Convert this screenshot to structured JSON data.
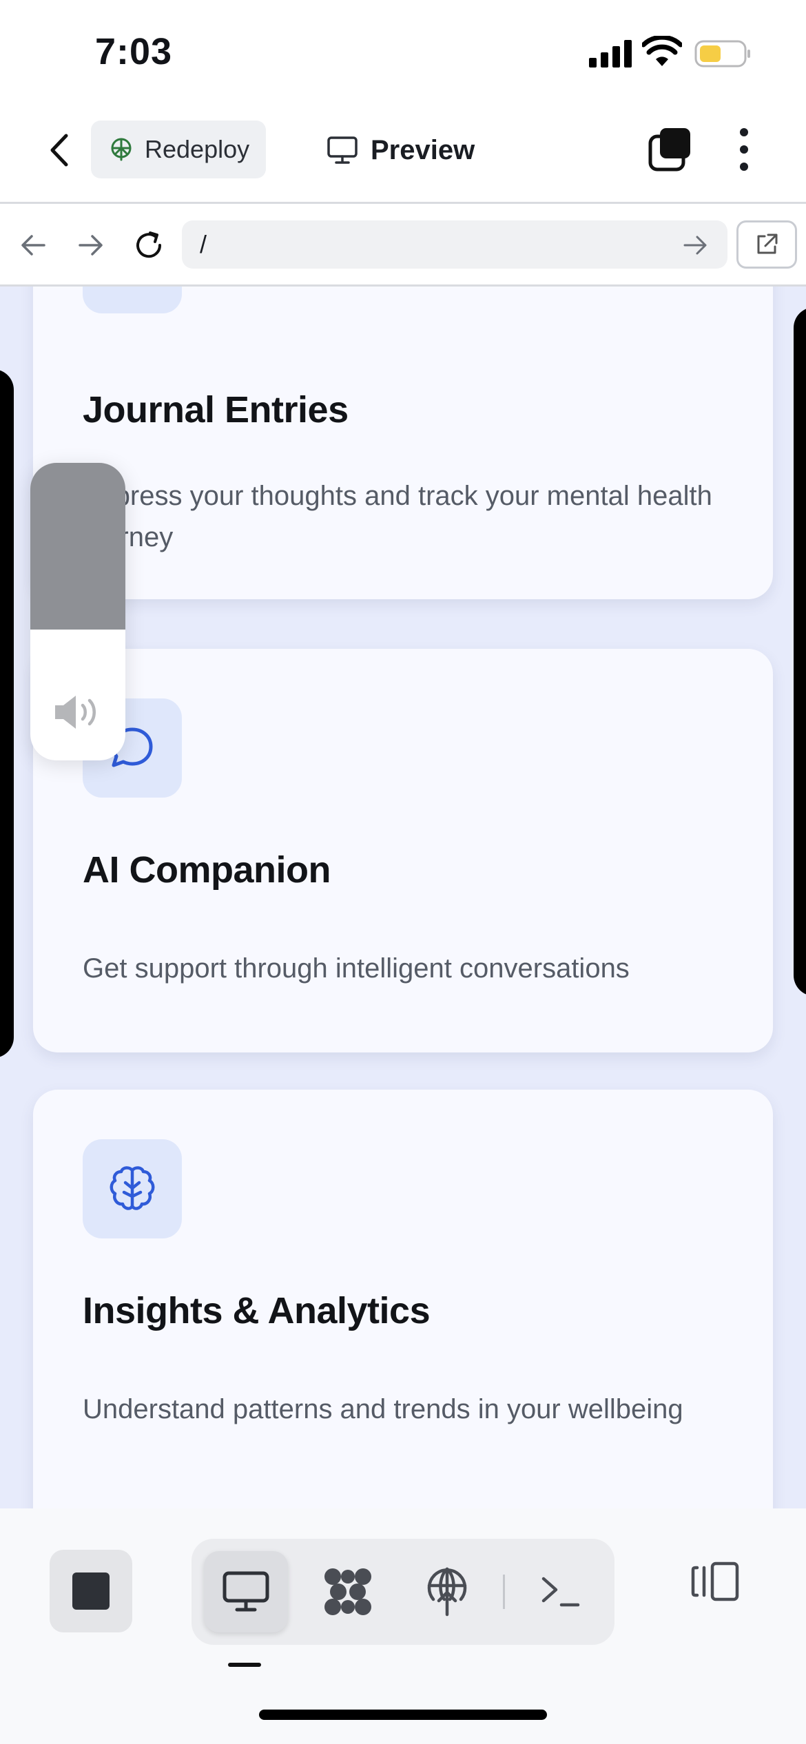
{
  "status_bar": {
    "time": "7:03"
  },
  "header": {
    "redeploy_label": "Redeploy",
    "preview_label": "Preview"
  },
  "url_bar": {
    "value": "/"
  },
  "cards": [
    {
      "title": "Journal Entries",
      "description": "Express your thoughts and track your mental health journey",
      "icon": "journal-icon"
    },
    {
      "title": "AI Companion",
      "description": "Get support through intelligent conversations",
      "icon": "chat-bubble-icon"
    },
    {
      "title": "Insights & Analytics",
      "description": "Understand patterns and trends in your wellbeing",
      "icon": "brain-icon"
    }
  ],
  "volume": {
    "level": 0.56
  },
  "toolbar": {
    "tools": [
      "preview-tool",
      "apps-tool",
      "deploy-tool",
      "terminal-tool"
    ],
    "active": "preview-tool"
  },
  "colors": {
    "accent": "#2f5bd8",
    "icon_bg": "#dfe7fb",
    "page_bg": "#e7ebfb",
    "card_bg": "#f8f9ff",
    "battery": "#f6cd45"
  }
}
